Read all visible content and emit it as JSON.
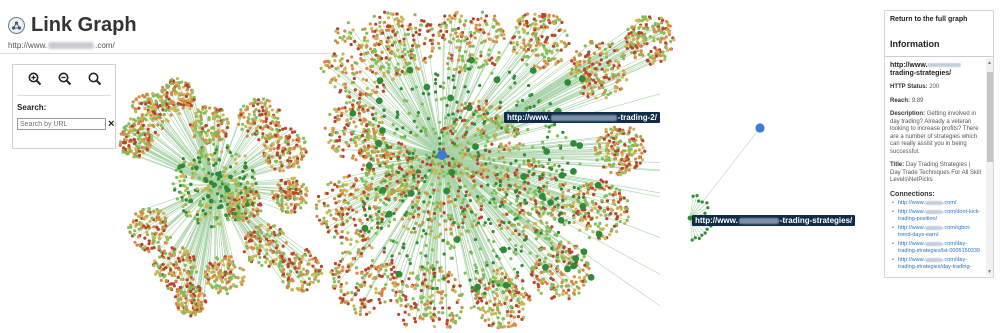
{
  "app": {
    "title": "Link Graph",
    "url_prefix": "http://www.",
    "url_suffix": ".com/"
  },
  "controls": {
    "zoom_in_icon": "zoom-in-icon",
    "zoom_out_icon": "zoom-out-icon",
    "zoom_reset_icon": "zoom-reset-icon",
    "search_label": "Search:",
    "search_placeholder": "Search by URL",
    "clear_label": "×"
  },
  "labels": {
    "hover_prefix": "http://www.",
    "hover_suffix": "-trading-2/",
    "selected_prefix": "http://www.",
    "selected_suffix": "-trading-strategies/"
  },
  "info": {
    "back_link": "Return to the full graph",
    "heading": "Information",
    "node_url_prefix": "http://www.",
    "node_url_suffix": "trading-strategies/",
    "http_status_key": "HTTP Status:",
    "http_status_value": "200",
    "reach_key": "Reach:",
    "reach_value": "9.89",
    "description_key": "Description:",
    "description_value": "Getting involved in day trading? Already a veteran looking to increase profits? There are a number of strategies which can really assist you in being successful.",
    "title_key": "Title:",
    "title_value": "Day Trading Strategies | Day Trade Techniques For All Skill Levels\\NetPicks",
    "connections_title": "Connections:",
    "connections": [
      {
        "pre": "http://www.",
        "post": ".com/"
      },
      {
        "pre": "http://www.",
        "post": ".com/dont-lock-trading-position/"
      },
      {
        "pre": "http://www.",
        "post": ".com/rgbot-trend-days-earn/"
      },
      {
        "pre": "http://www.",
        "post": ".com/day-trading-strategies/lst-0005150339"
      },
      {
        "pre": "http://www.",
        "post": ".com/day-trading-strategies/day-trading-"
      }
    ]
  },
  "colors": {
    "node_dark_green": "#2f8a3a",
    "node_light_green": "#7fbf5b",
    "node_yellow": "#c9b654",
    "node_orange": "#d58a45",
    "node_red": "#b8442e",
    "node_selected": "#3f7ccf",
    "edge": "#a9d3a8"
  }
}
